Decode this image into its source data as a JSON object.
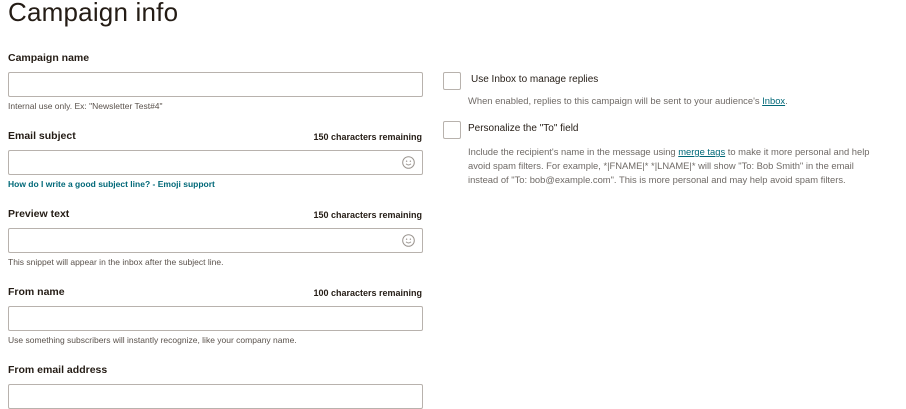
{
  "page": {
    "title": "Campaign info"
  },
  "fields": {
    "campaign_name": {
      "label": "Campaign name",
      "value": "",
      "help": "Internal use only. Ex: \"Newsletter Test#4\""
    },
    "email_subject": {
      "label": "Email subject",
      "remaining": "150 characters remaining",
      "value": "",
      "help_link_1": "How do I write a good subject line?",
      "help_sep": " - ",
      "help_link_2": "Emoji support"
    },
    "preview_text": {
      "label": "Preview text",
      "remaining": "150 characters remaining",
      "value": "",
      "help": "This snippet will appear in the inbox after the subject line."
    },
    "from_name": {
      "label": "From name",
      "remaining": "100 characters remaining",
      "value": "",
      "help": "Use something subscribers will instantly recognize, like your company name."
    },
    "from_email": {
      "label": "From email address"
    }
  },
  "options": {
    "use_inbox": {
      "label": "Use Inbox to manage replies",
      "checked": false,
      "desc_prefix": "When enabled, replies to this campaign will be sent to your audience's ",
      "desc_link": "Inbox",
      "desc_suffix": "."
    },
    "personalize_to": {
      "label": "Personalize the \"To\" field",
      "checked": false,
      "desc_prefix": "Include the recipient's name in the message using ",
      "desc_link": "merge tags",
      "desc_suffix": " to make it more personal and help avoid spam filters. For example, *|FNAME|* *|LNAME|* will show \"To: Bob Smith\" in the email instead of \"To: bob@example.com\". This is more personal and may help avoid spam filters."
    }
  },
  "icons": {
    "emoji": "smiley-icon"
  },
  "colors": {
    "link": "#006878",
    "border": "#b8b2ad",
    "text": "#241c15"
  }
}
